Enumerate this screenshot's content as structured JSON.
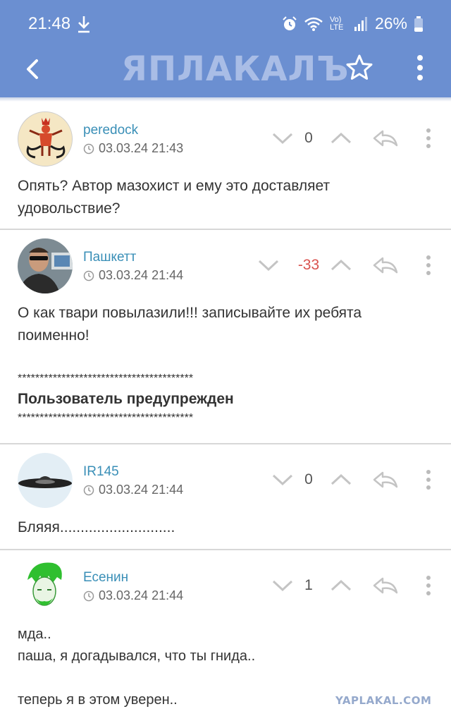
{
  "status_bar": {
    "time": "21:48",
    "network": "Vo) LTE",
    "battery": "26%"
  },
  "app_bar": {
    "logo": "ЯПЛАКАЛЪ"
  },
  "comments": [
    {
      "author": "peredock",
      "date": "03.03.24 21:43",
      "score": "0",
      "lines": [
        "Опять? Автор мазохист и ему это доставляет",
        "удовольствие?"
      ]
    },
    {
      "author": "Пашкетт",
      "date": "03.03.24 21:44",
      "score": "-33",
      "lines": [
        "О как твари повылазили!!! записывайте их ребята",
        "поименно!"
      ],
      "stars_top": "****************************************",
      "warning": "Пользователь предупрежден",
      "stars_bottom": "****************************************"
    },
    {
      "author": "IR145",
      "date": "03.03.24 21:44",
      "score": "0",
      "lines": [
        "Бляяя............................"
      ]
    },
    {
      "author": "Есенин",
      "date": "03.03.24 21:44",
      "score": "1",
      "lines": [
        "мда..",
        "паша, я догадывался, что ты гнида..",
        "",
        "теперь я в этом уверен.."
      ]
    }
  ],
  "watermark": "YAPLAKAL.COM",
  "colors": {
    "header": "#6b8fd1",
    "author": "#3a8fb7",
    "negative_score": "#d9534f"
  },
  "icons": [
    "download-icon",
    "alarm-icon",
    "wifi-icon",
    "signal-icon",
    "battery-icon",
    "back-arrow-icon",
    "star-icon",
    "more-vertical-icon",
    "clock-icon",
    "chevron-down-icon",
    "chevron-up-icon",
    "reply-icon"
  ]
}
